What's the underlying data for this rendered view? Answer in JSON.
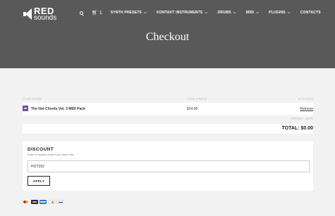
{
  "brand": {
    "name_top": "RED",
    "name_bottom": "sounds"
  },
  "nav": {
    "cart_count": "1",
    "items": [
      {
        "label": "SYNTH PRESETS",
        "has_dropdown": true
      },
      {
        "label": "KONTAKT INSTRUMENTS",
        "has_dropdown": true
      },
      {
        "label": "DRUMS",
        "has_dropdown": true
      },
      {
        "label": "MIDI",
        "has_dropdown": true
      },
      {
        "label": "PLUGINS",
        "has_dropdown": true
      },
      {
        "label": "CONTACTS",
        "has_dropdown": false
      }
    ]
  },
  "page": {
    "title": "Checkout"
  },
  "cart": {
    "columns": {
      "name": "ITEM NAME",
      "price": "ITEM PRICE",
      "actions": "ACTIONS"
    },
    "items": [
      {
        "name": "The Hot Chords Vol. 3 MIDI Pack",
        "price": "$14.00",
        "action": "Remove"
      }
    ],
    "coupon_applied": "HOT252 - 100%",
    "total": "TOTAL: $0.00"
  },
  "discount": {
    "title": "DISCOUNT",
    "hint": "Enter a coupon code if you have one.",
    "input_value": "HOT252",
    "apply_label": "APPLY"
  },
  "payment_icons": [
    "mastercard-icon",
    "visa-icon",
    "amex-icon",
    "discover-icon",
    "paypal-icon"
  ],
  "colors": {
    "header_bg": "#595959",
    "page_bg": "#f2f2f2",
    "thumb": "#7a4e9a"
  }
}
